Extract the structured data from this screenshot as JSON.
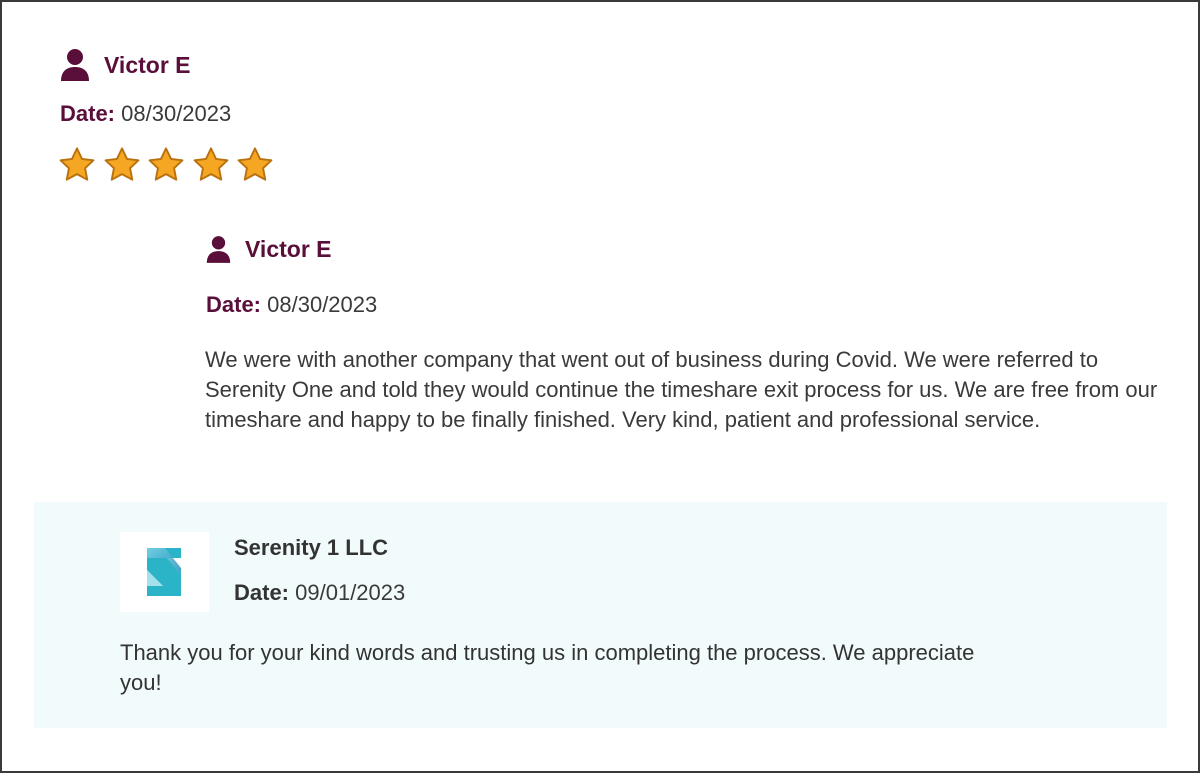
{
  "review": {
    "author": "Victor E",
    "date_label": "Date:",
    "date": "08/30/2023",
    "rating": 5,
    "rating_max": 5
  },
  "detail": {
    "author": "Victor E",
    "date_label": "Date:",
    "date": "08/30/2023",
    "text": "We were with another company that went out of business during Covid. We were referred to Serenity One and told they would continue the timeshare exit process for us. We are free from our timeshare and happy to be finally finished. Very kind, patient and professional service."
  },
  "reply": {
    "company": "Serenity 1 LLC",
    "date_label": "Date:",
    "date": "09/01/2023",
    "text": "Thank you for your kind words and trusting us in completing the process. We appreciate you!"
  },
  "colors": {
    "accent": "#5a0f3a",
    "star_fill": "#f5a623",
    "star_stroke": "#b8710d",
    "reply_bg": "#f1fbfb",
    "logo_teal": "#2bb3c8"
  },
  "icons": {
    "user": "user-icon",
    "star": "star-icon",
    "logo": "serenity-logo"
  }
}
